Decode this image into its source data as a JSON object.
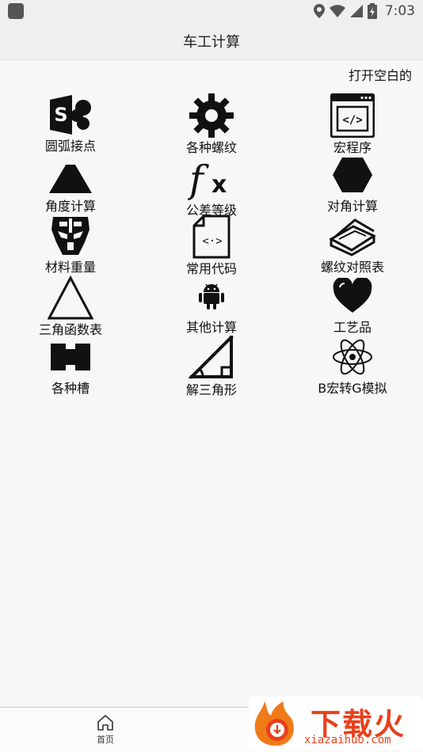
{
  "status_bar": {
    "time": "7:03"
  },
  "app_bar": {
    "title": "车工计算"
  },
  "marquee": {
    "text": "打开空白的页面"
  },
  "grid": [
    {
      "label": "圆弧接点",
      "icon": "sharepoint-icon"
    },
    {
      "label": "各种螺纹",
      "icon": "gear-icon"
    },
    {
      "label": "宏程序",
      "icon": "code-window-icon"
    },
    {
      "label": "角度计算",
      "icon": "triangle-filled-icon"
    },
    {
      "label": "公差等级",
      "icon": "function-fx-icon"
    },
    {
      "label": "对角计算",
      "icon": "hexagon-icon"
    },
    {
      "label": "材料重量",
      "icon": "transformers-icon"
    },
    {
      "label": "常用代码",
      "icon": "code-file-icon"
    },
    {
      "label": "螺纹对照表",
      "icon": "book-icon"
    },
    {
      "label": "三角函数表",
      "icon": "triangle-outline-icon"
    },
    {
      "label": "其他计算",
      "icon": "android-icon"
    },
    {
      "label": "工艺品",
      "icon": "heart-icon"
    },
    {
      "label": "各种槽",
      "icon": "slot-icon"
    },
    {
      "label": "解三角形",
      "icon": "right-triangle-icon"
    },
    {
      "label": "B宏转G模拟",
      "icon": "atom-icon"
    }
  ],
  "bottom_nav": {
    "home_label": "首页"
  },
  "watermark": {
    "cn": "下载火",
    "en": "xiazaihuo.com"
  },
  "colors": {
    "background": "#f7f7f7",
    "bar": "#efefef",
    "watermark": "#e8401c"
  }
}
